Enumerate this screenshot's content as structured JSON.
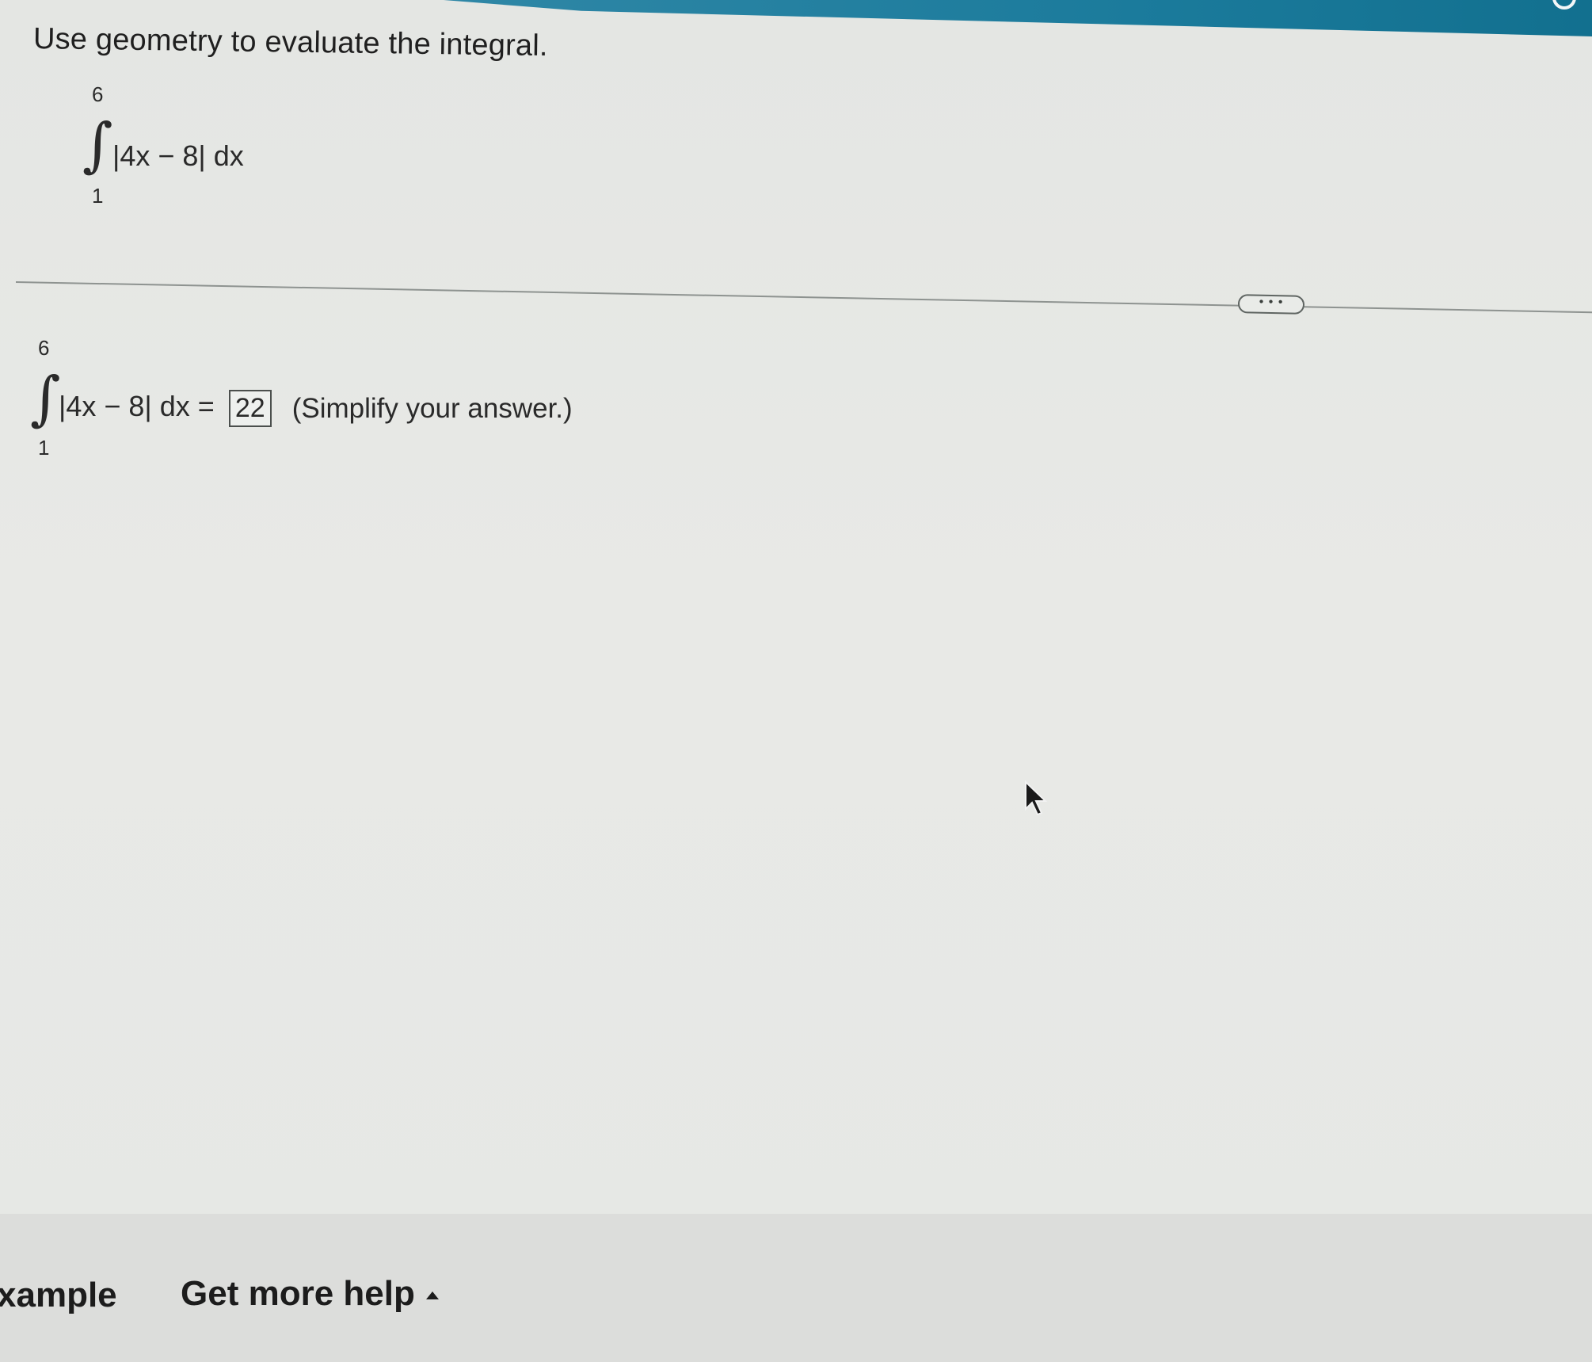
{
  "question": {
    "prompt": "Use geometry to evaluate the integral.",
    "integral": {
      "upper": "6",
      "lower": "1",
      "sign": "∫",
      "integrand": "|4x − 8| dx"
    }
  },
  "more_button": {
    "label": "• • •"
  },
  "answer": {
    "integral": {
      "upper": "6",
      "lower": "1",
      "sign": "∫",
      "integrand": "|4x − 8| dx ="
    },
    "value": "22",
    "hint": "(Simplify your answer.)"
  },
  "footer": {
    "example_label": "xample",
    "help_label": "Get more help"
  },
  "icons": {
    "refresh": "refresh-icon",
    "cursor": "mouse-pointer-icon",
    "caret": "caret-up-icon"
  }
}
